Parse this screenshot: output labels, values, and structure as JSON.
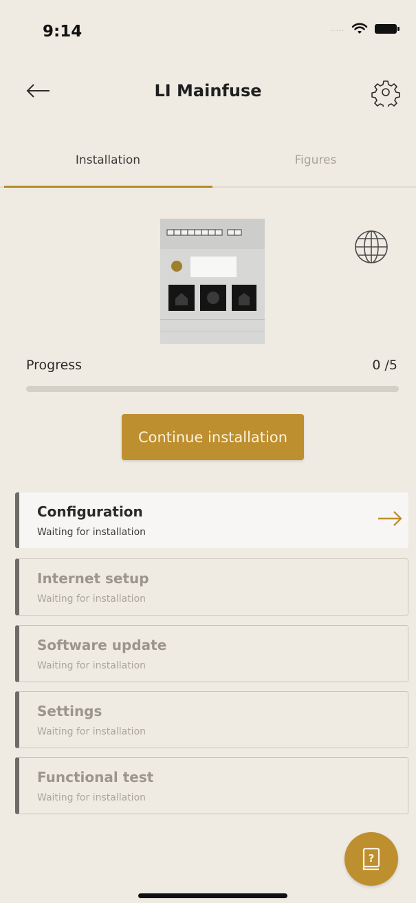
{
  "status_bar": {
    "time": "9:14",
    "signal_text": "....."
  },
  "header": {
    "title": "LI Mainfuse"
  },
  "tabs": [
    {
      "label": "Installation",
      "active": true
    },
    {
      "label": "Figures",
      "active": false
    }
  ],
  "progress": {
    "label": "Progress",
    "count": "0 /5",
    "completed": 0,
    "total": 5
  },
  "cta": {
    "label": "Continue installation"
  },
  "steps": [
    {
      "title": "Configuration",
      "status": "Waiting for installation"
    },
    {
      "title": "Internet setup",
      "status": "Waiting for installation"
    },
    {
      "title": "Software update",
      "status": "Waiting for installation"
    },
    {
      "title": "Settings",
      "status": "Waiting for installation"
    },
    {
      "title": "Functional test",
      "status": "Waiting for installation"
    }
  ],
  "icons": {
    "back": "arrow-left-icon",
    "settings": "gear-icon",
    "language": "globe-icon",
    "next": "arrow-right-icon",
    "help": "help-book-icon",
    "wifi": "wifi-icon",
    "battery": "battery-icon"
  },
  "colors": {
    "accent": "#be8f2e",
    "background": "#efebe2",
    "text": "#2b2b2b"
  }
}
